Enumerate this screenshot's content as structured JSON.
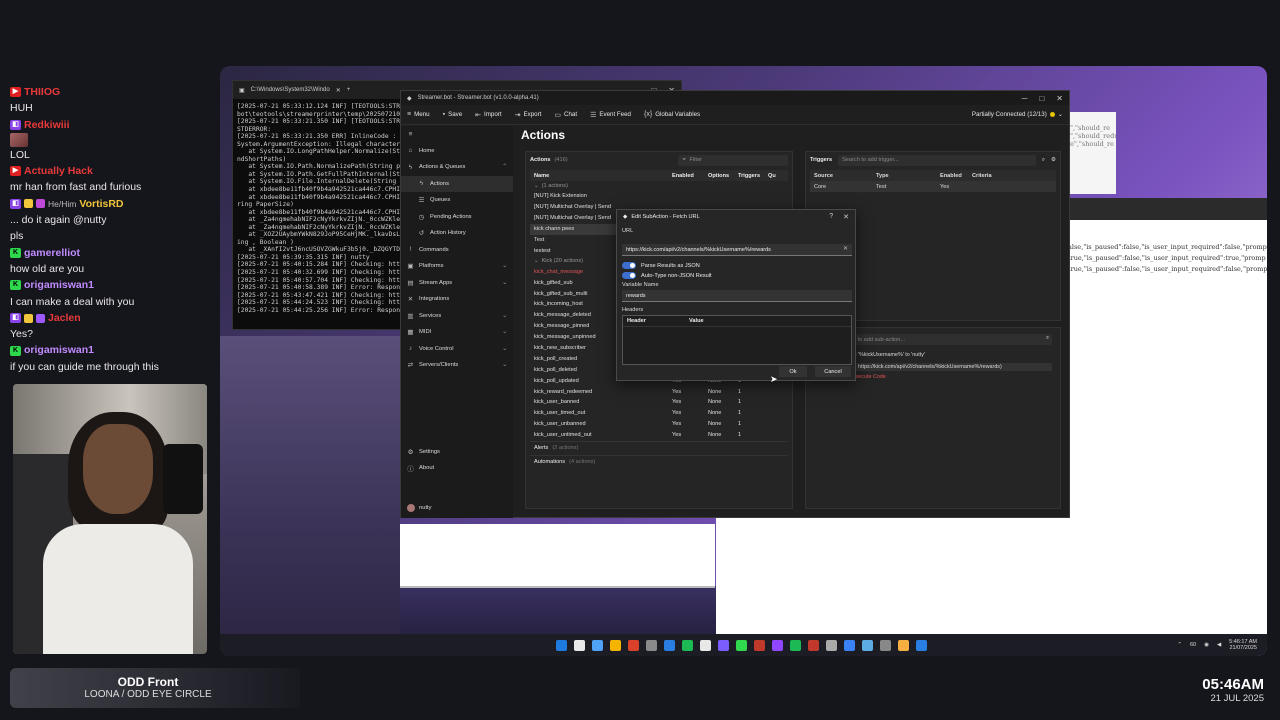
{
  "chat": [
    {
      "platform": "yt",
      "name": "THIIOG",
      "name_color": "#e83a3a",
      "text": "HUH",
      "badges": []
    },
    {
      "platform": "tw",
      "name": "Redkiwiii",
      "name_color": "#e83a3a",
      "text": "LOL",
      "badges": [],
      "emote": true
    },
    {
      "platform": "yt",
      "name": "Actually Hack",
      "name_color": "#e83a3a",
      "text": "mr han from fast and furious",
      "badges": []
    },
    {
      "platform": "tw",
      "name": "VortisRD",
      "name_color": "#f0c63c",
      "pronoun": "He/Him",
      "text": "... do it again @nutty",
      "badges": [
        "#f0c63c",
        "#c04ad8"
      ]
    },
    {
      "platform": "tw",
      "name": "",
      "name_color": "#ffffff",
      "text": "pls",
      "badges": []
    },
    {
      "platform": "kk",
      "name": "gamerelliot",
      "name_color": "#c08cff",
      "text": "how old are you",
      "badges": []
    },
    {
      "platform": "kk",
      "name": "origamiswan1",
      "name_color": "#c08cff",
      "text": "I can make a deal with you",
      "badges": []
    },
    {
      "platform": "tw",
      "name": "Jaclen",
      "name_color": "#e83a3a",
      "text": "Yes?",
      "badges": [
        "#f0c63c",
        "#9b59ff"
      ]
    },
    {
      "platform": "kk",
      "name": "origamiswan1",
      "name_color": "#c08cff",
      "text": "if you can guide me through this",
      "badges": []
    }
  ],
  "now_playing": {
    "title": "ODD Front",
    "artist": "LOONA / ODD EYE CIRCLE"
  },
  "clock": {
    "time": "05:46AM",
    "date": "21 JUL 2025"
  },
  "cmd": {
    "title": "C:\\Windows\\System32\\Windo",
    "lines": [
      "[2025-07-21 05:33:12.124 INF] [TEOTOOLS:STRE",
      "bot\\teotools\\streamerprinter\\temp\\2025072105",
      "[2025-07-21 05:33:21.350 INF] [TEOTOOLS:STRE",
      "STDERROR:",
      "[2025-07-21 05:33:21.350 ERR] InlineCode :",
      "System.ArgumentException: Illegal characters",
      "   at System.IO.LongPathHelper.Normalize(Str",
      "ndShortPaths)",
      "   at System.IO.Path.NormalizePath(String pa",
      "   at System.IO.Path.GetFullPathInternal(Str",
      "   at System.IO.File.InternalDelete(String p",
      "   at xbdee8be11fb40f9b4a942521ca446c7.CPHIn",
      "   at xbdee8be11fb40f9b4a942521ca446c7.CPHIn",
      "ring PaperSize)",
      "   at xbdee8be11fb40f9b4a942521ca446c7.CPHIn",
      "   at _Za4ngmehabNIF2cNyYkrkvZIjN._0ccWZKle",
      "   at _Za4ngmehabNIF2cNyYkrkvZIjN._0ccWZKle",
      "   at _XOZ2UAybmYWkN829JoP95CeHjMK._lkavDsL",
      "ing , Boolean )",
      "   at _XAnfI2vtJ6ncU5OVZGWkuF3b5j0._bZQGYTDL",
      "[2025-07-21 05:39:35.315 INF] nutty",
      "[2025-07-21 05:40:15.284 INF] Checking: http",
      "[2025-07-21 05:40:32.699 INF] Checking: http",
      "[2025-07-21 05:40:57.704 INF] Checking: http",
      "[2025-07-21 05:40:58.389 INF] Error: Respons",
      "[2025-07-21 05:43:47.421 INF] Checking: http",
      "[2025-07-21 05:44:24.523 INF] Checking: http",
      "[2025-07-21 05:44:25.256 INF] Error: Respons"
    ]
  },
  "browser_text": [
    "alse,\"is_paused\":false,\"is_user_input_required\":false,\"promp",
    "true,\"is_paused\":false,\"is_user_input_required\":true,\"promp",
    "true,\"is_paused\":false,\"is_user_input_required\":false,\"promp"
  ],
  "browser_a_text": [
    "\",\"should_re",
    "\",\"should_redu",
    "e\",\"should_re"
  ],
  "sb": {
    "title": "Streamer.bot - Streamer.bot (v1.0.0-alpha.41)",
    "toolbar": {
      "menu": "Menu",
      "save": "Save",
      "import": "Import",
      "export": "Export",
      "chat": "Chat",
      "event_feed": "Event Feed",
      "global_vars": "Global Variables"
    },
    "status": "Partially Connected (12/13)",
    "sidebar": {
      "home": "Home",
      "actions_queues": "Actions & Queues",
      "actions": "Actions",
      "queues": "Queues",
      "pending": "Pending Actions",
      "history": "Action History",
      "commands": "Commands",
      "platforms": "Platforms",
      "stream_apps": "Stream Apps",
      "integrations": "Integrations",
      "services": "Services",
      "midi": "MIDI",
      "voice": "Voice Control",
      "servers": "Servers/Clients",
      "settings": "Settings",
      "about": "About",
      "user": "nutty"
    },
    "page_title": "Actions",
    "actions": {
      "label": "Actions",
      "count": "(416)",
      "filter_placeholder": "Filter",
      "cols": {
        "name": "Name",
        "enabled": "Enabled",
        "options": "Options",
        "triggers": "Triggers",
        "queue": "Qu"
      },
      "group_top": "(1 actions)",
      "rows_top": [
        {
          "name": "[NUT] Kick Extension"
        },
        {
          "name": "[NUT] Multichat Overlay | Send"
        },
        {
          "name": "[NUT] Multichat Overlay | Send"
        },
        {
          "name": "kick chann pees",
          "selected": true
        },
        {
          "name": "Test"
        },
        {
          "name": "testest"
        }
      ],
      "group_mid": "Kick (20 actions)",
      "rows_mid": [
        {
          "name": "kick_chat_message",
          "en": "",
          "op": "",
          "tr": "",
          "error": true
        },
        {
          "name": "kick_gifted_sub",
          "en": "",
          "op": "",
          "tr": ""
        },
        {
          "name": "kick_gifted_sub_multi",
          "en": "",
          "op": "",
          "tr": ""
        },
        {
          "name": "kick_incoming_host",
          "en": "",
          "op": "",
          "tr": ""
        },
        {
          "name": "kick_message_deleted",
          "en": "",
          "op": "",
          "tr": ""
        },
        {
          "name": "kick_message_pinned",
          "en": "",
          "op": "",
          "tr": ""
        },
        {
          "name": "kick_message_unpinned",
          "en": "",
          "op": "",
          "tr": ""
        },
        {
          "name": "kick_new_subscriber",
          "en": "",
          "op": "",
          "tr": ""
        },
        {
          "name": "kick_poll_created",
          "en": "Yes",
          "op": "None",
          "tr": "1"
        },
        {
          "name": "kick_poll_deleted",
          "en": "Yes",
          "op": "None",
          "tr": "1"
        },
        {
          "name": "kick_poll_updated",
          "en": "Yes",
          "op": "None",
          "tr": "1"
        },
        {
          "name": "kick_reward_redeemed",
          "en": "Yes",
          "op": "None",
          "tr": "1"
        },
        {
          "name": "kick_user_banned",
          "en": "Yes",
          "op": "None",
          "tr": "1"
        },
        {
          "name": "kick_user_timed_out",
          "en": "Yes",
          "op": "None",
          "tr": "1"
        },
        {
          "name": "kick_user_unbanned",
          "en": "Yes",
          "op": "None",
          "tr": "1"
        },
        {
          "name": "kick_user_untimed_out",
          "en": "Yes",
          "op": "None",
          "tr": "1"
        }
      ],
      "group_alerts": "Alerts",
      "group_alerts_count": "(2 actions)",
      "group_automations": "Automations",
      "group_automations_count": "(4 actions)"
    },
    "triggers": {
      "label": "Triggers",
      "search_placeholder": "Search to add trigger...",
      "cols": {
        "source": "Source",
        "type": "Type",
        "enabled": "Enabled",
        "criteria": "Criteria"
      },
      "rows": [
        {
          "source": "Core",
          "type": "Test",
          "enabled": "Yes",
          "criteria": ""
        }
      ]
    },
    "subactions": {
      "search_placeholder": "ch to add sub-action...",
      "row1": "nt '%kickUsername%' to 'nutty'",
      "row2": "https://kick.com/api/v2/channels/%kickUsername%/rewards)",
      "row3": "Execute Code"
    }
  },
  "dialog": {
    "title": "Edit SubAction - Fetch URL",
    "url_label": "URL",
    "url_value": "https://kick.com/api/v2/channels/%kickUsername%/rewards",
    "parse_json": "Parse Results as JSON",
    "auto_type": "Auto-Type non-JSON Result",
    "var_label": "Variable Name",
    "var_value": "rewards",
    "headers_label": "Headers",
    "headers_cols": {
      "header": "Header",
      "value": "Value"
    },
    "ok": "Ok",
    "cancel": "Cancel"
  },
  "taskbar": {
    "tray_text": "60",
    "time": "5:46:17 AM",
    "date": "21/07/2025"
  },
  "colors": {
    "accent": "#3c6fd0",
    "error": "#e05454",
    "kick": "#2fd84c",
    "twitch": "#8a44e6",
    "youtube": "#e02020"
  }
}
